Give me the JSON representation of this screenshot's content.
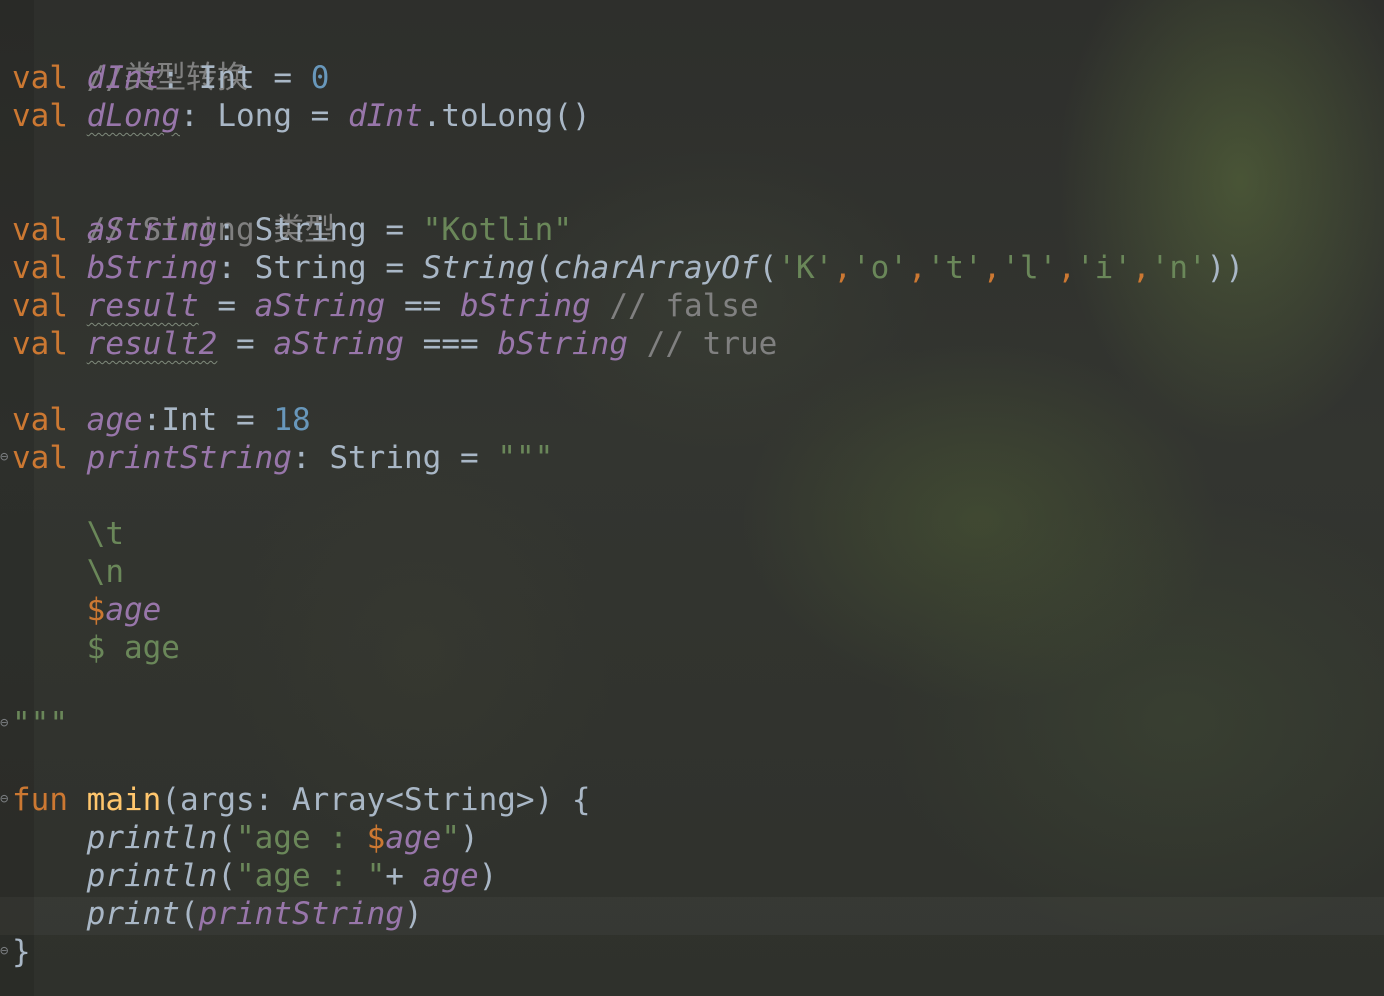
{
  "code": {
    "lines": {
      "l1": {
        "comment": "//类型转换"
      },
      "l2": {
        "kw": "val",
        "name": "dInt",
        "colon": ":",
        "type": "Int",
        "eq": "=",
        "value": "0"
      },
      "l3": {
        "kw": "val",
        "name": "dLong",
        "colon": ":",
        "type": "Long",
        "eq": "=",
        "ref": "dInt",
        "call": ".toLong()"
      },
      "l5": {
        "comment": "// String 类型"
      },
      "l6": {
        "kw": "val",
        "name": "aString",
        "colon": ":",
        "type": "String",
        "eq": "=",
        "value": "\"Kotlin\""
      },
      "l7": {
        "kw": "val",
        "name": "bString",
        "colon": ":",
        "type": "String",
        "eq": "=",
        "ctor": "String",
        "open": "(",
        "fn": "charArrayOf",
        "open2": "(",
        "chars": [
          "'K'",
          "'o'",
          "'t'",
          "'l'",
          "'i'",
          "'n'"
        ],
        "comma": ",",
        "close": "))"
      },
      "l8": {
        "kw": "val",
        "name": "result",
        "eq": "=",
        "left": "aString",
        "op": "==",
        "right": "bString",
        "comment": "// false"
      },
      "l9": {
        "kw": "val",
        "name": "result2",
        "eq": "=",
        "left": "aString",
        "op": "===",
        "right": "bString",
        "comment": "// true"
      },
      "l11": {
        "kw": "val",
        "name": "age",
        "colon": ":",
        "type": "Int",
        "eq": "=",
        "value": "18"
      },
      "l12": {
        "kw": "val",
        "name": "printString",
        "colon": ":",
        "type": "String",
        "eq": "=",
        "open": "\"\"\""
      },
      "l14": {
        "text": "\\t"
      },
      "l15": {
        "text": "\\n"
      },
      "l16": {
        "dollar": "$",
        "name": "age"
      },
      "l17": {
        "text": "$ age"
      },
      "l19": {
        "close": "\"\"\""
      },
      "l21": {
        "kw": "fun",
        "name": "main",
        "sig": "(args: Array<String>) {"
      },
      "l22": {
        "fn": "println",
        "open": "(",
        "str_start": "\"age : ",
        "tmpl_dollar": "$",
        "tmpl_name": "age",
        "str_end": "\"",
        "close": ")"
      },
      "l23": {
        "fn": "println",
        "open": "(",
        "str": "\"age : \"",
        "plus": "+ ",
        "arg": "age",
        "close": ")"
      },
      "l24": {
        "fn": "print",
        "open": "(",
        "arg": "printString",
        "close": ")"
      },
      "l25": {
        "brace": "}"
      }
    }
  }
}
